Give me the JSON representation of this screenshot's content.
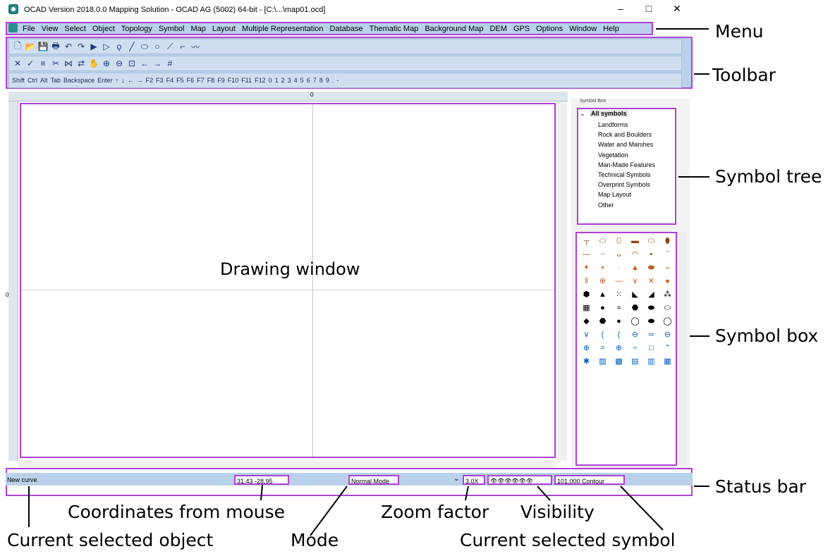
{
  "window": {
    "title": "OCAD Version 2018.0.0  Mapping Solution - OCAD AG (5002) 64-bit - [C:\\...\\map01.ocd]",
    "minimize": "–",
    "maximize": "□",
    "close": "✕"
  },
  "menu": [
    "File",
    "View",
    "Select",
    "Object",
    "Topology",
    "Symbol",
    "Map",
    "Layout",
    "Multiple Representation",
    "Database",
    "Thematic Map",
    "Background Map",
    "DEM",
    "GPS",
    "Options",
    "Window",
    "Help"
  ],
  "keys_toolbar": [
    "Shift",
    "Ctrl",
    "Alt",
    "Tab",
    "Backspace",
    "Enter",
    "↑",
    "↓",
    "←",
    "→",
    "F2",
    "F3",
    "F4",
    "F5",
    "F6",
    "F7",
    "F8",
    "F9",
    "F10",
    "F11",
    "F12",
    "0",
    "1",
    "2",
    "3",
    "4",
    "5",
    "6",
    "7",
    "8",
    "9",
    ".",
    "-"
  ],
  "ruler": {
    "top_zero": "0",
    "left_zero": "0"
  },
  "drawing_label": "Drawing window",
  "symbol_box": {
    "header": "Symbol Box",
    "root": "All symbols",
    "tree": [
      "Landforms",
      "Rock and Boulders",
      "Water and Marshes",
      "Vegetation",
      "Man-Made Features",
      "Technical Symbols",
      "Overprint Symbols",
      "Map Layout",
      "Other"
    ]
  },
  "status": {
    "object": "New curve",
    "coords": "31.43  -28.95",
    "mode": "Normal Mode",
    "zoom": "3.0X",
    "visibility": "👁👁👁👁👁👁",
    "symbol": "101.000 Contour"
  },
  "annotations": {
    "menu": "Menu",
    "toolbar": "Toolbar",
    "symbol_tree": "Symbol tree",
    "symbol_box": "Symbol box",
    "status_bar": "Status bar",
    "coordinates": "Coordinates from mouse",
    "zoom": "Zoom factor",
    "visibility": "Visibility",
    "current_object": "Current selected object",
    "mode": "Mode",
    "current_symbol": "Current selected symbol"
  },
  "colors": {
    "highlight": "#b040d8",
    "chrome": "#b9d1ea",
    "accent": "#2b8f8f"
  }
}
